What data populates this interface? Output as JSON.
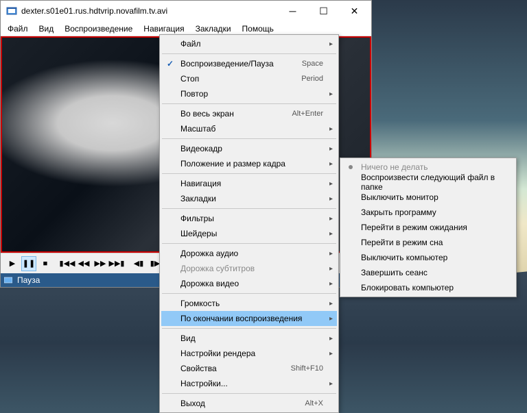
{
  "window": {
    "title": "dexter.s01e01.rus.hdtvrip.novafilm.tv.avi"
  },
  "menubar": {
    "items": [
      "Файл",
      "Вид",
      "Воспроизведение",
      "Навигация",
      "Закладки",
      "Помощь"
    ]
  },
  "status": {
    "text": "Пауза"
  },
  "dropdown_main": [
    {
      "type": "item",
      "label": "Файл",
      "arrow": true
    },
    {
      "type": "sep"
    },
    {
      "type": "item",
      "label": "Воспроизведение/Пауза",
      "shortcut": "Space",
      "check": true
    },
    {
      "type": "item",
      "label": "Стоп",
      "shortcut": "Period"
    },
    {
      "type": "item",
      "label": "Повтор",
      "arrow": true
    },
    {
      "type": "sep"
    },
    {
      "type": "item",
      "label": "Во весь экран",
      "shortcut": "Alt+Enter"
    },
    {
      "type": "item",
      "label": "Масштаб",
      "arrow": true
    },
    {
      "type": "sep"
    },
    {
      "type": "item",
      "label": "Видеокадр",
      "arrow": true
    },
    {
      "type": "item",
      "label": "Положение и размер кадра",
      "arrow": true
    },
    {
      "type": "sep"
    },
    {
      "type": "item",
      "label": "Навигация",
      "arrow": true
    },
    {
      "type": "item",
      "label": "Закладки",
      "arrow": true
    },
    {
      "type": "sep"
    },
    {
      "type": "item",
      "label": "Фильтры",
      "arrow": true
    },
    {
      "type": "item",
      "label": "Шейдеры",
      "arrow": true
    },
    {
      "type": "sep"
    },
    {
      "type": "item",
      "label": "Дорожка аудио",
      "arrow": true
    },
    {
      "type": "item",
      "label": "Дорожка субтитров",
      "arrow": true,
      "disabled": true
    },
    {
      "type": "item",
      "label": "Дорожка видео",
      "arrow": true
    },
    {
      "type": "sep"
    },
    {
      "type": "item",
      "label": "Громкость",
      "arrow": true
    },
    {
      "type": "item",
      "label": "По окончании воспроизведения",
      "arrow": true,
      "highlight": true
    },
    {
      "type": "sep"
    },
    {
      "type": "item",
      "label": "Вид",
      "arrow": true
    },
    {
      "type": "item",
      "label": "Настройки рендера",
      "arrow": true
    },
    {
      "type": "item",
      "label": "Свойства",
      "shortcut": "Shift+F10"
    },
    {
      "type": "item",
      "label": "Настройки...",
      "arrow": true
    },
    {
      "type": "sep"
    },
    {
      "type": "item",
      "label": "Выход",
      "shortcut": "Alt+X"
    }
  ],
  "dropdown_sub": [
    {
      "type": "item",
      "label": "Ничего не делать",
      "bullet": true,
      "disabled": true
    },
    {
      "type": "item",
      "label": "Воспроизвести следующий файл в папке"
    },
    {
      "type": "item",
      "label": "Выключить монитор"
    },
    {
      "type": "item",
      "label": "Закрыть программу"
    },
    {
      "type": "item",
      "label": "Перейти в режим ожидания"
    },
    {
      "type": "item",
      "label": "Перейти в режим сна"
    },
    {
      "type": "item",
      "label": "Выключить компьютер"
    },
    {
      "type": "item",
      "label": "Завершить сеанс"
    },
    {
      "type": "item",
      "label": "Блокировать компьютер"
    }
  ]
}
